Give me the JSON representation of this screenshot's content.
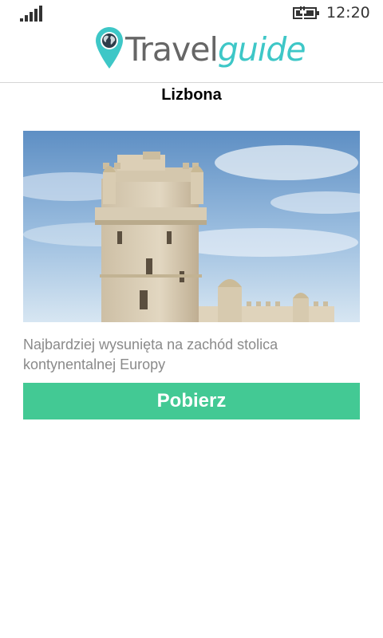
{
  "status_bar": {
    "time": "12:20",
    "icons": {
      "signal": "signal-strength-icon",
      "battery": "battery-charging-icon"
    }
  },
  "header": {
    "logo_travel": "Travel",
    "logo_guide": "guide",
    "logo_icon": "globe-pin-icon",
    "colors": {
      "travel": "#666666",
      "guide": "#3ec7c7"
    }
  },
  "place": {
    "title": "Lizbona",
    "description": "Najbardziej wysunięta na zachód stolica kontynentalnej Europy",
    "image": "tower-photo"
  },
  "actions": {
    "download_label": "Pobierz",
    "download_color": "#43c994"
  }
}
